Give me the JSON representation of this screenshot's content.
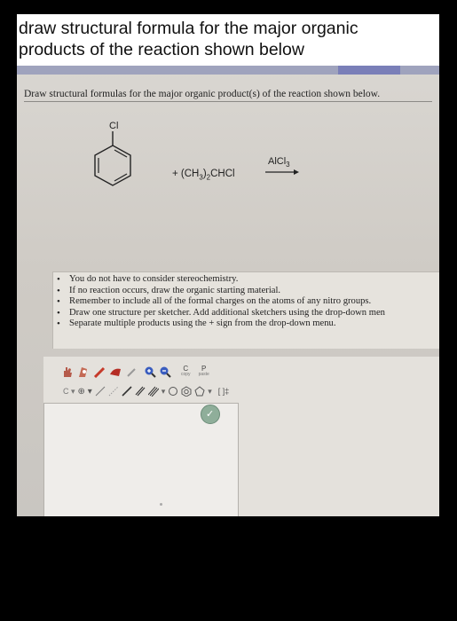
{
  "question": {
    "line1": "draw structural formula for the major organic",
    "line2": "products of the reaction shown below"
  },
  "screen": {
    "instruction": "Draw structural formulas for the major organic product(s) of the reaction shown below.",
    "reaction": {
      "substituent": "Cl",
      "reagent_prefix": "+ (CH",
      "reagent_sub1": "3",
      "reagent_mid": ")",
      "reagent_sub2": "2",
      "reagent_suffix": "CHCl",
      "catalyst": "AlCl",
      "catalyst_sub": "3"
    },
    "bullets": [
      "You do not have to consider stereochemistry.",
      "If no reaction occurs, draw the organic starting material.",
      "Remember to include all of the formal charges on the atoms of any nitro groups.",
      "Draw one structure per sketcher. Add additional sketchers using the drop-down men",
      "Separate multiple products using the + sign from the drop-down menu."
    ],
    "toolbar": {
      "copy_label": "C",
      "copy_sub": "copy",
      "paste_label": "P",
      "paste_sub": "paste",
      "row2_tail": "[ ]‡"
    },
    "colors": {
      "blue_button": "#7a7fb8",
      "canvas_bg": "#efedea"
    }
  }
}
